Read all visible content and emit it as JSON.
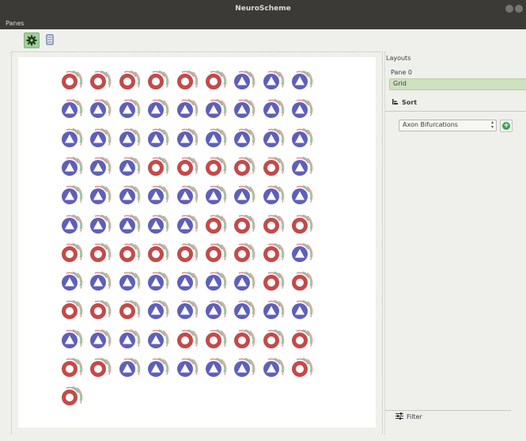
{
  "window": {
    "title": "NeuroScheme"
  },
  "menu": {
    "panes_label": "Panes"
  },
  "toolbar": {
    "items": [
      "gear-icon",
      "list-icon"
    ]
  },
  "panel": {
    "layouts_label": "Layouts",
    "pane_label": "Pane 0",
    "layout_value": "Grid",
    "sort_tab_label": "Sort",
    "sort_value": "Axon Bifurcations",
    "filter_tab_label": "Filter"
  },
  "colors": {
    "triangle_disk": "#5f5fbb",
    "ring": "#c44a4a",
    "active_button": "#9fcd9c",
    "selected_layout": "#cfe0bf"
  },
  "grid": {
    "columns": 9,
    "glyphs": [
      "R",
      "R",
      "R",
      "R",
      "R",
      "R",
      "T",
      "T",
      "T",
      "T",
      "T",
      "T",
      "T",
      "T",
      "T",
      "T",
      "T",
      "T",
      "T",
      "T",
      "T",
      "T",
      "T",
      "T",
      "T",
      "T",
      "T",
      "T",
      "T",
      "T",
      "R",
      "R",
      "R",
      "R",
      "R",
      "T",
      "T",
      "T",
      "T",
      "T",
      "T",
      "T",
      "T",
      "T",
      "T",
      "T",
      "T",
      "T",
      "T",
      "T",
      "R",
      "R",
      "R",
      "R",
      "R",
      "R",
      "R",
      "R",
      "R",
      "R",
      "R",
      "R",
      "T",
      "T",
      "T",
      "T",
      "T",
      "T",
      "T",
      "T",
      "R",
      "R",
      "R",
      "R",
      "R",
      "T",
      "T",
      "T",
      "T",
      "T",
      "T",
      "T",
      "T",
      "T",
      "T",
      "R",
      "R",
      "R",
      "R",
      "R",
      "R",
      "R",
      "T",
      "T",
      "T",
      "T",
      "T",
      "T",
      "R",
      "R"
    ]
  }
}
